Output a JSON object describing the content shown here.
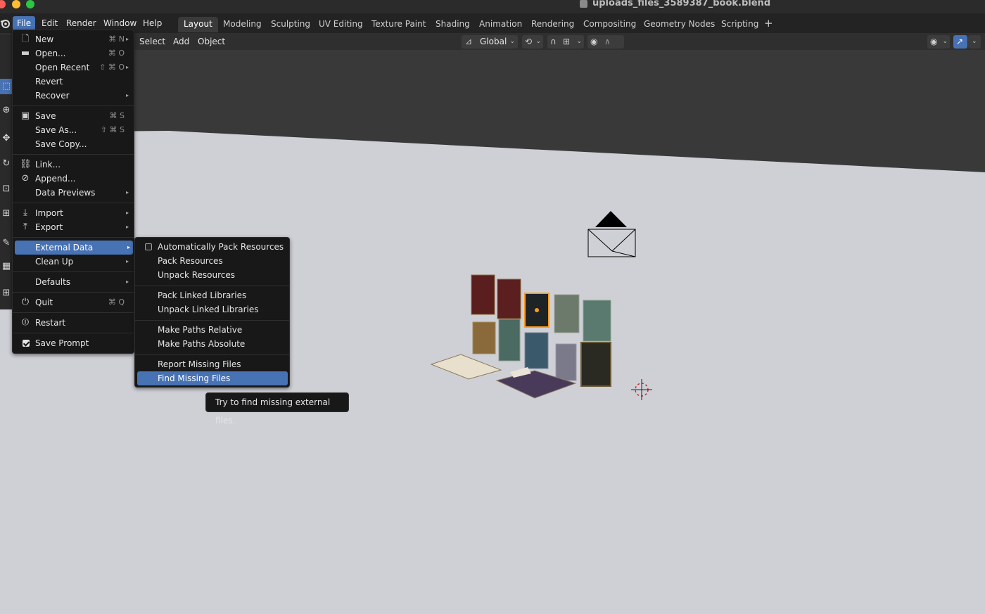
{
  "window": {
    "title": "uploads_files_3589387_book.blend"
  },
  "topbar": {
    "menus": [
      "File",
      "Edit",
      "Render",
      "Window",
      "Help"
    ],
    "workspaces": [
      "Layout",
      "Modeling",
      "Sculpting",
      "UV Editing",
      "Texture Paint",
      "Shading",
      "Animation",
      "Rendering",
      "Compositing",
      "Geometry Nodes",
      "Scripting"
    ],
    "add_label": "+"
  },
  "header": {
    "menus": [
      "Select",
      "Add",
      "Object"
    ],
    "transform_orientation": "Global"
  },
  "file_menu": {
    "items": [
      {
        "label": "New",
        "shortcut": "⌘ N",
        "arrow": "▸",
        "icon": "new-file-icon"
      },
      {
        "label": "Open...",
        "shortcut": "⌘ O",
        "icon": "folder-icon"
      },
      {
        "label": "Open Recent",
        "shortcut": "⇧ ⌘ O",
        "arrow": "▸"
      },
      {
        "label": "Revert"
      },
      {
        "label": "Recover",
        "arrow": "▸"
      },
      {
        "label": "Save",
        "shortcut": "⌘ S",
        "icon": "save-icon"
      },
      {
        "label": "Save As...",
        "shortcut": "⇧ ⌘ S"
      },
      {
        "label": "Save Copy..."
      },
      {
        "label": "Link...",
        "icon": "link-icon"
      },
      {
        "label": "Append...",
        "icon": "append-icon"
      },
      {
        "label": "Data Previews",
        "arrow": "▸"
      },
      {
        "label": "Import",
        "arrow": "▸",
        "icon": "import-icon"
      },
      {
        "label": "Export",
        "arrow": "▸",
        "icon": "export-icon"
      },
      {
        "label": "External Data",
        "arrow": "▸"
      },
      {
        "label": "Clean Up",
        "arrow": "▸"
      },
      {
        "label": "Defaults",
        "arrow": "▸"
      },
      {
        "label": "Quit",
        "shortcut": "⌘ Q",
        "icon": "power-icon"
      },
      {
        "label": "Restart",
        "icon": "restart-icon"
      },
      {
        "label": "Save Prompt"
      }
    ]
  },
  "external_data_menu": {
    "items": [
      {
        "label": "Automatically Pack Resources"
      },
      {
        "label": "Pack Resources"
      },
      {
        "label": "Unpack Resources"
      },
      {
        "label": "Pack Linked Libraries"
      },
      {
        "label": "Unpack Linked Libraries"
      },
      {
        "label": "Make Paths Relative"
      },
      {
        "label": "Make Paths Absolute"
      },
      {
        "label": "Report Missing Files"
      },
      {
        "label": "Find Missing Files"
      }
    ]
  },
  "tooltip": {
    "text": "Try to find missing external files."
  },
  "colors": {
    "accent": "#4772b3",
    "menu_bg": "#181818",
    "topbar_bg": "#232323"
  }
}
